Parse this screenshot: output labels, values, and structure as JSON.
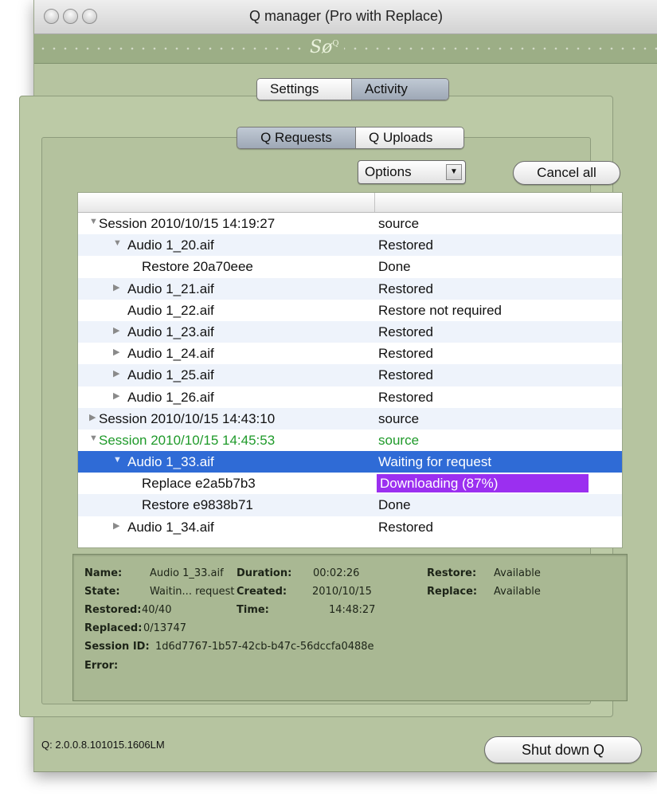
{
  "window": {
    "title": "Q manager (Pro with Replace)"
  },
  "logo": {
    "text": "Sø",
    "sup": "Q"
  },
  "main_tabs": [
    {
      "label": "Settings",
      "selected": false
    },
    {
      "label": "Activity",
      "selected": true
    }
  ],
  "sub_tabs": [
    {
      "label": "Q Requests",
      "selected": true
    },
    {
      "label": "Q Uploads",
      "selected": false
    }
  ],
  "toolbar": {
    "options_label": "Options",
    "cancel_all_label": "Cancel all"
  },
  "rows": [
    {
      "name": "Session 2010/10/15 14:19:27",
      "status": "source",
      "indent": 0,
      "disclosure": "open"
    },
    {
      "name": "Audio 1_20.aif",
      "status": "Restored",
      "indent": 1,
      "disclosure": "open"
    },
    {
      "name": "Restore 20a70eee",
      "status": "Done",
      "indent": 2,
      "disclosure": "none"
    },
    {
      "name": "Audio 1_21.aif",
      "status": "Restored",
      "indent": 1,
      "disclosure": "closed"
    },
    {
      "name": "Audio 1_22.aif",
      "status": "Restore not required",
      "indent": 1,
      "disclosure": "none"
    },
    {
      "name": "Audio 1_23.aif",
      "status": "Restored",
      "indent": 1,
      "disclosure": "closed"
    },
    {
      "name": "Audio 1_24.aif",
      "status": "Restored",
      "indent": 1,
      "disclosure": "closed"
    },
    {
      "name": "Audio 1_25.aif",
      "status": "Restored",
      "indent": 1,
      "disclosure": "closed"
    },
    {
      "name": "Audio 1_26.aif",
      "status": "Restored",
      "indent": 1,
      "disclosure": "closed"
    },
    {
      "name": "Session 2010/10/15 14:43:10",
      "status": "source",
      "indent": 0,
      "disclosure": "closed"
    },
    {
      "name": "Session 2010/10/15 14:45:53",
      "status": "source",
      "indent": 0,
      "disclosure": "open",
      "color": "#1f9a2a"
    },
    {
      "name": "Audio 1_33.aif",
      "status": "Waiting for request",
      "indent": 1,
      "disclosure": "open",
      "selected": true
    },
    {
      "name": "Replace e2a5b7b3",
      "status": "Downloading (87%)",
      "indent": 2,
      "disclosure": "none",
      "highlight": "#9b2ff0"
    },
    {
      "name": "Restore e9838b71",
      "status": "Done",
      "indent": 2,
      "disclosure": "none"
    },
    {
      "name": "Audio 1_34.aif",
      "status": "Restored",
      "indent": 1,
      "disclosure": "closed"
    }
  ],
  "details": {
    "name_label": "Name:",
    "name_value": "Audio 1_33.aif",
    "state_label": "State:",
    "state_value": "Waitin... request",
    "restored_label": "Restored:",
    "restored_value": "40/40",
    "replaced_label": "Replaced:",
    "replaced_value": "0/13747",
    "session_id_label": "Session ID:",
    "session_id_value": "1d6d7767-1b57-42cb-b47c-56dccfa0488e",
    "error_label": "Error:",
    "duration_label": "Duration:",
    "duration_value": "00:02:26",
    "created_label": "Created:",
    "created_value": "2010/10/15",
    "time_label": "Time:",
    "time_value": "14:48:27",
    "restore_label": "Restore:",
    "restore_value": "Available",
    "replace_label": "Replace:",
    "replace_value": "Available"
  },
  "footer": {
    "version": "Q: 2.0.0.8.101015.1606LM",
    "shutdown_label": "Shut down Q"
  }
}
